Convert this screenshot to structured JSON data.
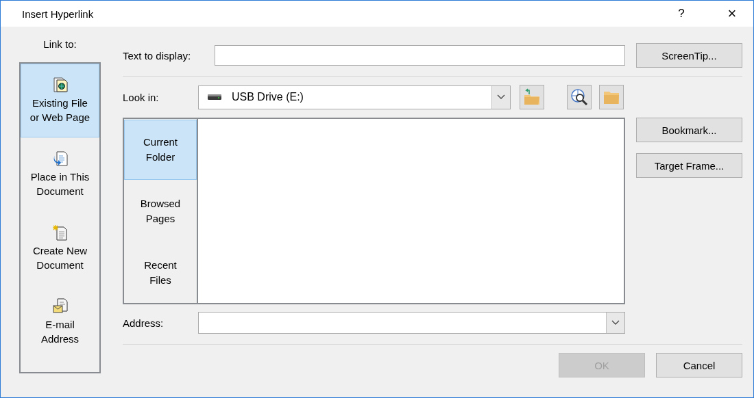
{
  "window": {
    "title": "Insert Hyperlink",
    "help": "?",
    "close": "×"
  },
  "link_to": {
    "label": "Link to:",
    "items": [
      {
        "label": "Existing File or Web Page",
        "kind": "file",
        "selected": true
      },
      {
        "label": "Place in This Document",
        "kind": "place",
        "selected": false
      },
      {
        "label": "Create New Document",
        "kind": "new",
        "selected": false
      },
      {
        "label": "E-mail Address",
        "kind": "email",
        "selected": false
      }
    ]
  },
  "text_to_display": {
    "label": "Text to display:"
  },
  "screentip_button": {
    "label": "ScreenTip...",
    "disabled": false
  },
  "look_in": {
    "label": "Look in:",
    "value": "USB Drive (E:)"
  },
  "browse_nav": [
    {
      "label": "Current Folder",
      "selected": true
    },
    {
      "label": "Browsed Pages",
      "selected": false
    },
    {
      "label": "Recent Files",
      "selected": false
    }
  ],
  "side_buttons": [
    {
      "label": "Bookmark...",
      "disabled": false
    },
    {
      "label": "Target Frame...",
      "disabled": false
    }
  ],
  "address": {
    "label": "Address:"
  },
  "footer_buttons": [
    {
      "label": "OK",
      "disabled": true
    },
    {
      "label": "Cancel",
      "disabled": false
    }
  ]
}
